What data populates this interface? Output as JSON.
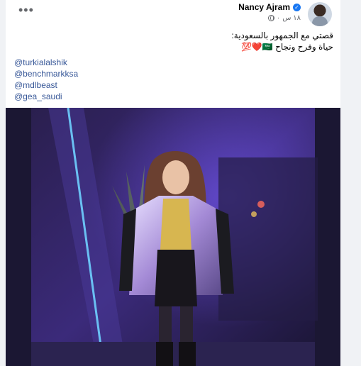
{
  "post": {
    "author": "Nancy Ajram",
    "time": "١٨ س",
    "caption_lines": [
      "قصتي مع الجمهور بالسعودية:",
      "حياة وفرح ونجاح 🇸🇦❤️💯"
    ],
    "mentions": [
      "@turkialalshik",
      "@benchmarkksa",
      "@mdlbeast",
      "@gea_saudi"
    ]
  },
  "icons": {
    "more": "more-options-icon",
    "verified": "verified-badge-icon",
    "audience": "globe-icon"
  },
  "colors": {
    "link": "#385898",
    "verified": "#1877f2",
    "page_bg": "#f0f2f5"
  }
}
